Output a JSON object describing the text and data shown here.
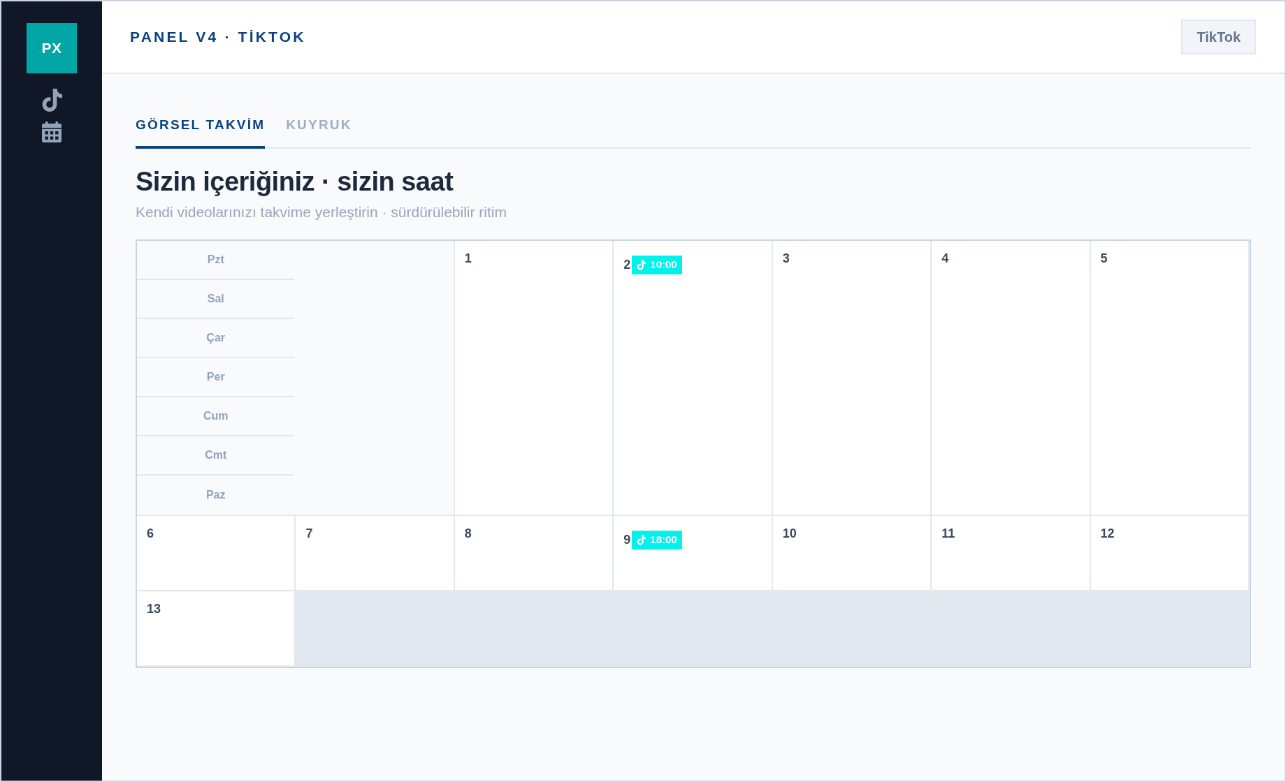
{
  "sidebar": {
    "logo": "PX"
  },
  "header": {
    "title": "PANEL V4 · TİKTOK",
    "button": "TikTok"
  },
  "tabs": [
    {
      "label": "GÖRSEL TAKVİM",
      "selected": true
    },
    {
      "label": "KUYRUK",
      "selected": false
    }
  ],
  "heading": "Sizin içeriğiniz · sizin saat",
  "subtitle": "Kendi videolarınızı takvime yerleştirin · sürdürülebilir ritim",
  "calendar": {
    "weekdays": [
      "Pzt",
      "Sal",
      "Çar",
      "Per",
      "Cum",
      "Cmt",
      "Paz"
    ],
    "days": [
      {
        "day": "1"
      },
      {
        "day": "2",
        "events": [
          {
            "time": "10:00"
          }
        ]
      },
      {
        "day": "3"
      },
      {
        "day": "4"
      },
      {
        "day": "5"
      },
      {
        "day": "6"
      },
      {
        "day": "7"
      },
      {
        "day": "8"
      },
      {
        "day": "9",
        "events": [
          {
            "time": "18:00"
          }
        ]
      },
      {
        "day": "10"
      },
      {
        "day": "11"
      },
      {
        "day": "12"
      },
      {
        "day": "13"
      }
    ]
  }
}
